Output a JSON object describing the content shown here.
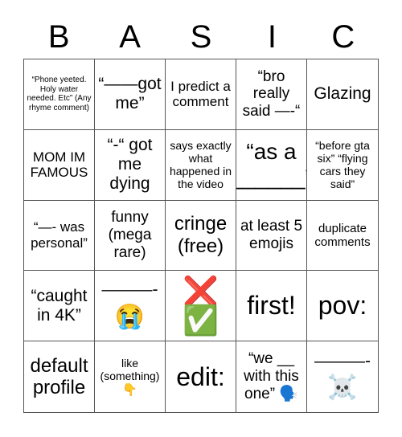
{
  "title_letters": [
    "B",
    "A",
    "S",
    "I",
    "C"
  ],
  "cells": [
    {
      "text": "“Phone yeeted. Holy water needed. Etc” (Any rhyme comment)"
    },
    {
      "text": "“——got me”"
    },
    {
      "text": "I predict a comment"
    },
    {
      "text": "“bro really said —-“"
    },
    {
      "text": "Glazing"
    },
    {
      "text": "MOM IM FAMOUS"
    },
    {
      "text": "“-“ got me dying"
    },
    {
      "text": "says exactly what happened in the video"
    },
    {
      "text": "“as a ______”"
    },
    {
      "text": "“before gta six” “flying cars they said”"
    },
    {
      "text": "“—- was personal”"
    },
    {
      "text": "funny (mega rare)"
    },
    {
      "text": "cringe (free)"
    },
    {
      "text": "at least 5 emojis"
    },
    {
      "text": "duplicate comments"
    },
    {
      "text": "“caught in 4K”"
    },
    {
      "text": "———-",
      "emoji": "😭"
    },
    {
      "text": "❌",
      "emoji": "✅"
    },
    {
      "text": "first!"
    },
    {
      "text": "pov:"
    },
    {
      "text": "default profile"
    },
    {
      "text": "like (something)",
      "emoji": "👇"
    },
    {
      "text": "edit:"
    },
    {
      "text": "“we __ with this one”",
      "emoji": "🗣️"
    },
    {
      "text": "———-",
      "emoji": "☠️"
    }
  ]
}
